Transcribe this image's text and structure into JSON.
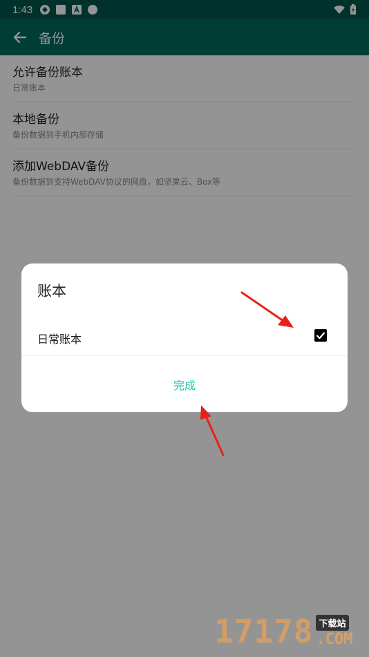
{
  "status_bar": {
    "time": "1:43"
  },
  "app_bar": {
    "title": "备份",
    "back_icon": "arrow-left-icon"
  },
  "preferences": [
    {
      "title": "允许备份账本",
      "summary": "日常账本"
    },
    {
      "title": "本地备份",
      "summary": "备份数据到手机内部存储"
    },
    {
      "title": "添加WebDAV备份",
      "summary": "备份数据到支持WebDAV协议的网盘，如坚果云、Box等"
    }
  ],
  "dialog": {
    "title": "账本",
    "item_label": "日常账本",
    "item_checked": true,
    "done_label": "完成"
  },
  "colors": {
    "status_bar": "#00574b",
    "app_bar": "#00695c",
    "accent": "#26bfae",
    "annotation": "#e8201a"
  },
  "watermark": {
    "number": "17178",
    "tag": "下载站",
    "suffix": ".COM"
  }
}
